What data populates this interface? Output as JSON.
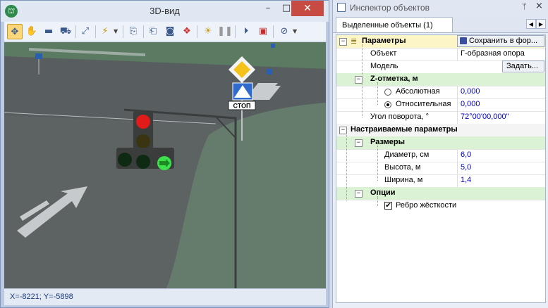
{
  "window3d": {
    "title": "3D-вид",
    "minimize": "–",
    "maximize": "□",
    "close": "✕"
  },
  "toolbar": {
    "icons": [
      "move-icon",
      "hand-icon",
      "camera-icon",
      "car-icon",
      "zoom-extents-icon",
      "lightning-icon",
      "copy-view-icon",
      "snapshot-icon",
      "photo-icon",
      "layers-icon",
      "scene-icon",
      "pause-icon",
      "record-icon",
      "save-video-icon",
      "compass-icon"
    ]
  },
  "scene": {
    "sign_stop_text": "СТОП"
  },
  "status": {
    "coords": "X=-8221; Y=-5898"
  },
  "inspector": {
    "title": "Инспектор объектов",
    "pin": "ᛘ",
    "close": "×",
    "tab": "Выделенные объекты (1)",
    "nav_left": "◀",
    "nav_right": "▶",
    "params": {
      "header": "Параметры",
      "save_button": "Сохранить в фор...",
      "object_label": "Объект",
      "object_value": "Г-образная опора",
      "model_label": "Модель",
      "model_button": "Задать...",
      "z_header": "Z-отметка, м",
      "abs_label": "Абсолютная",
      "abs_value": "0,000",
      "abs_selected": false,
      "rel_label": "Относительная",
      "rel_value": "0,000",
      "rel_selected": true,
      "angle_label": "Угол поворота, °",
      "angle_value": "72°00'00,000\""
    },
    "custom": {
      "header": "Настраиваемые параметры",
      "sizes_header": "Размеры",
      "diameter_label": "Диаметр, см",
      "diameter_value": "6,0",
      "height_label": "Высота, м",
      "height_value": "5,0",
      "width_label": "Ширина, м",
      "width_value": "1,4",
      "options_header": "Опции",
      "rib_label": "Ребро жёсткости",
      "rib_checked": true
    }
  },
  "colors": {
    "title_close": "#c74b43",
    "value_text": "#0000c8",
    "category_yellow": "#fbf5c8",
    "category_green": "#dbf3d4"
  }
}
